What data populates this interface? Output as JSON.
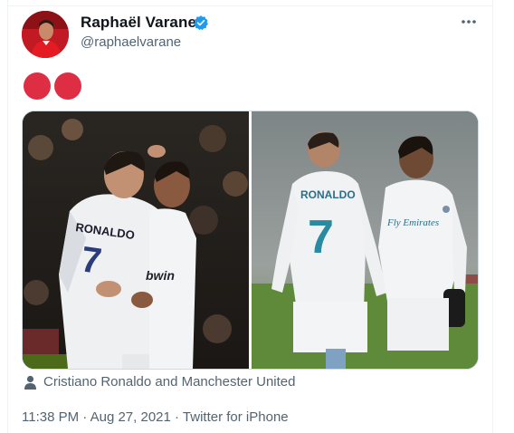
{
  "tweet": {
    "author": {
      "display_name": "Raphaël Varane",
      "handle": "@raphaelvarane",
      "verified": true
    },
    "emoji": [
      "red-circle",
      "red-circle"
    ],
    "media": [
      {
        "jersey_name": "RONALDO",
        "jersey_number": "7",
        "kit_sponsor": "bwin"
      },
      {
        "jersey_name": "RONALDO",
        "jersey_number": "7",
        "kit_sponsor": "Fly Emirates"
      }
    ],
    "tagged_people": "Cristiano Ronaldo and Manchester United",
    "time": "11:38 PM",
    "date": "Aug 27, 2021",
    "source": "Twitter for iPhone",
    "separator": " · "
  },
  "colors": {
    "text_primary": "#0f1419",
    "text_secondary": "#536471",
    "verified_blue": "#1d9bf0",
    "emoji_red": "#dd2e44",
    "border": "#cfd9de"
  }
}
